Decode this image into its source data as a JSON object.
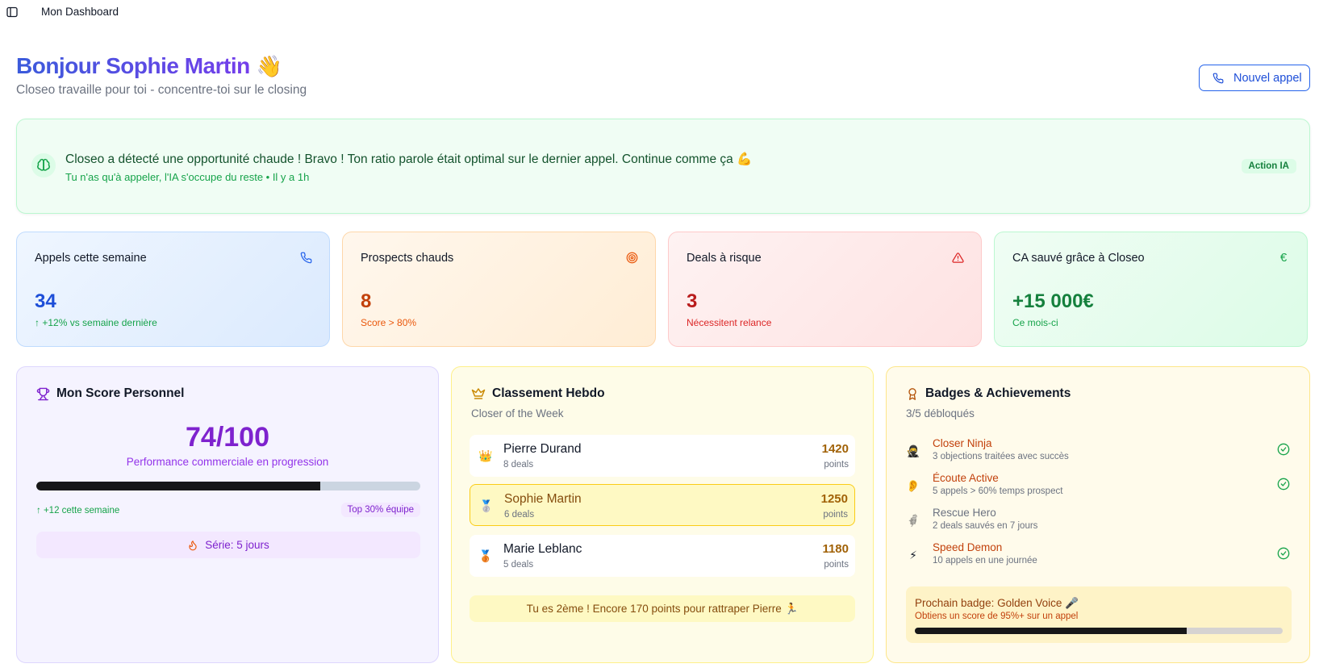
{
  "topbar": {
    "title": "Mon Dashboard",
    "toggle_icon": "sidebar-toggle-icon"
  },
  "header": {
    "greeting": "Bonjour Sophie Martin",
    "wave_emoji": "👋",
    "subtitle": "Closeo travaille pour toi - concentre-toi sur le closing",
    "new_call_label": "Nouvel appel"
  },
  "ai_banner": {
    "message": "Closeo a détecté une opportunité chaude ! Bravo ! Ton ratio parole était optimal sur le dernier appel. Continue comme ça 💪",
    "meta": "Tu n'as qu'à appeler, l'IA s'occupe du reste • Il y a 1h",
    "badge": "Action IA"
  },
  "stats": [
    {
      "label": "Appels cette semaine",
      "value": "34",
      "sub": "+12% vs semaine dernière",
      "icon": "phone-icon",
      "color": "#1d4ed8"
    },
    {
      "label": "Prospects chauds",
      "value": "8",
      "sub": "Score > 80%",
      "icon": "target-icon",
      "color": "#c2410c"
    },
    {
      "label": "Deals à risque",
      "value": "3",
      "sub": "Nécessitent relance",
      "icon": "warning-icon",
      "color": "#b91c1c"
    },
    {
      "label": "CA sauvé grâce à Closeo",
      "value": "+15 000€",
      "sub": "Ce mois-ci",
      "icon": "euro-icon",
      "color": "#15803d"
    }
  ],
  "score_panel": {
    "title": "Mon Score Personnel",
    "score": "74/100",
    "score_fraction": 0.74,
    "description": "Performance commerciale en progression",
    "delta": "+12 cette semaine",
    "rank_badge": "Top 30% équipe",
    "streak": "Série: 5 jours"
  },
  "ranking_panel": {
    "title": "Classement Hebdo",
    "subtitle": "Closer of the Week",
    "rows": [
      {
        "medal": "👑",
        "name": "Pierre Durand",
        "deals": "8 deals",
        "points": "1420",
        "points_label": "points"
      },
      {
        "medal": "🥈",
        "name": "Sophie Martin",
        "deals": "6 deals",
        "points": "1250",
        "points_label": "points"
      },
      {
        "medal": "🥉",
        "name": "Marie Leblanc",
        "deals": "5 deals",
        "points": "1180",
        "points_label": "points"
      }
    ],
    "note": "Tu es 2ème ! Encore 170 points pour rattraper Pierre 🏃"
  },
  "badges_panel": {
    "title": "Badges & Achievements",
    "subtitle": "3/5 débloqués",
    "items": [
      {
        "emoji": "🥷",
        "name": "Closer Ninja",
        "desc": "3 objections traitées avec succès",
        "unlocked": true
      },
      {
        "emoji": "👂",
        "name": "Écoute Active",
        "desc": "5 appels > 60% temps prospect",
        "unlocked": true
      },
      {
        "emoji": "🦸",
        "name": "Rescue Hero",
        "desc": "2 deals sauvés en 7 jours",
        "unlocked": false
      },
      {
        "emoji": "⚡",
        "name": "Speed Demon",
        "desc": "10 appels en une journée",
        "unlocked": true
      }
    ],
    "next_badge": {
      "title": "Prochain badge: Golden Voice 🎤",
      "sub": "Obtiens un score de 95%+ sur un appel",
      "progress": 0.74
    }
  }
}
